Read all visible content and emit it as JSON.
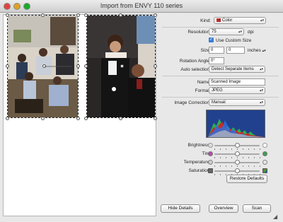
{
  "window": {
    "title": "Import from ENVY 110 series"
  },
  "settings": {
    "kind_label": "Kind:",
    "kind_value": "Color",
    "resolution_label": "Resolution:",
    "resolution_value": "75",
    "resolution_unit": "dpi",
    "use_custom_size_label": "Use Custom Size",
    "use_custom_size_checked": true,
    "size_label": "Size:",
    "size_width": "0",
    "size_height": "0",
    "size_unit": "inches",
    "rotation_label": "Rotation Angle:",
    "rotation_value": "0°",
    "auto_selection_label": "Auto selection:",
    "auto_selection_value": "Detect Separate Items",
    "name_label": "Name:",
    "name_value": "Scanned Image",
    "format_label": "Format:",
    "format_value": "JPEG",
    "image_correction_label": "Image Correction:",
    "image_correction_value": "Manual"
  },
  "adjustments": {
    "brightness_label": "Brightness:",
    "brightness_level": 0.5,
    "tint_label": "Tint:",
    "tint_level": 0.5,
    "temperature_label": "Temperature:",
    "temperature_level": 0.5,
    "saturation_label": "Saturation:",
    "saturation_level": 0.5
  },
  "buttons": {
    "restore_defaults": "Restore Defaults",
    "hide_details": "Hide Details",
    "overview": "Overview",
    "scan": "Scan"
  },
  "colors": {
    "close": "#e0443e",
    "minimize": "#dea123",
    "zoom": "#1aab29",
    "checkbox": "#3b7fd6"
  }
}
